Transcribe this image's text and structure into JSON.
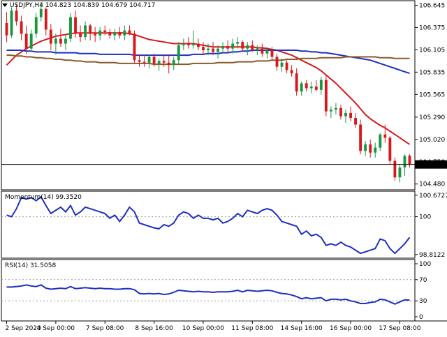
{
  "title": {
    "symbol": "USDJPY,H4",
    "ohlc": "104.823 104.839 104.679 104.717"
  },
  "colors": {
    "bull": "#1a9641",
    "bear": "#d7191c",
    "ma_fast": "#d7191c",
    "ma_mid": "#1f2fbf",
    "ma_slow": "#8b5a2b",
    "indicator": "#1f2fbf",
    "grid": "#9a9a9a",
    "current_price_bg": "#000000",
    "current_price_text": "#ffffff"
  },
  "chart_data": [
    {
      "type": "candlestick",
      "title": "USDJPY,H4",
      "ylim": [
        104.41,
        106.7
      ],
      "y_ticks": [
        "106.645",
        "106.375",
        "106.105",
        "105.835",
        "105.565",
        "105.290",
        "105.020",
        "104.750",
        "104.480"
      ],
      "current_price": "104.717",
      "current_value": 104.717,
      "x_tick_labels": [
        "2 Sep 2020",
        "4 Sep 00:00",
        "7 Sep 08:00",
        "8 Sep 16:00",
        "10 Sep 00:00",
        "11 Sep 08:00",
        "14 Sep 16:00",
        "16 Sep 00:00",
        "17 Sep 08:00"
      ],
      "x_tick_index": [
        0,
        10,
        20,
        30,
        40,
        50,
        60,
        70,
        80
      ],
      "candles": [
        {
          "o": 106.43,
          "h": 106.56,
          "l": 106.2,
          "c": 106.28
        },
        {
          "o": 106.28,
          "h": 106.62,
          "l": 106.25,
          "c": 106.58
        },
        {
          "o": 106.58,
          "h": 106.65,
          "l": 106.4,
          "c": 106.45
        },
        {
          "o": 106.45,
          "h": 106.52,
          "l": 106.22,
          "c": 106.3
        },
        {
          "o": 106.3,
          "h": 106.4,
          "l": 106.05,
          "c": 106.12
        },
        {
          "o": 106.12,
          "h": 106.35,
          "l": 106.08,
          "c": 106.3
        },
        {
          "o": 106.3,
          "h": 106.55,
          "l": 106.25,
          "c": 106.5
        },
        {
          "o": 106.5,
          "h": 106.68,
          "l": 106.45,
          "c": 106.6
        },
        {
          "o": 106.6,
          "h": 106.62,
          "l": 106.28,
          "c": 106.35
        },
        {
          "o": 106.35,
          "h": 106.42,
          "l": 106.1,
          "c": 106.18
        },
        {
          "o": 106.18,
          "h": 106.3,
          "l": 106.05,
          "c": 106.24
        },
        {
          "o": 106.24,
          "h": 106.36,
          "l": 106.14,
          "c": 106.18
        },
        {
          "o": 106.18,
          "h": 106.3,
          "l": 106.1,
          "c": 106.24
        },
        {
          "o": 106.24,
          "h": 106.55,
          "l": 106.2,
          "c": 106.5
        },
        {
          "o": 106.5,
          "h": 106.58,
          "l": 106.25,
          "c": 106.3
        },
        {
          "o": 106.3,
          "h": 106.4,
          "l": 106.2,
          "c": 106.26
        },
        {
          "o": 106.26,
          "h": 106.45,
          "l": 106.22,
          "c": 106.4
        },
        {
          "o": 106.4,
          "h": 106.42,
          "l": 106.22,
          "c": 106.3
        },
        {
          "o": 106.3,
          "h": 106.38,
          "l": 106.2,
          "c": 106.28
        },
        {
          "o": 106.28,
          "h": 106.38,
          "l": 106.22,
          "c": 106.34
        },
        {
          "o": 106.34,
          "h": 106.4,
          "l": 106.28,
          "c": 106.32
        },
        {
          "o": 106.32,
          "h": 106.36,
          "l": 106.24,
          "c": 106.28
        },
        {
          "o": 106.28,
          "h": 106.36,
          "l": 106.22,
          "c": 106.32
        },
        {
          "o": 106.32,
          "h": 106.38,
          "l": 106.24,
          "c": 106.28
        },
        {
          "o": 106.28,
          "h": 106.4,
          "l": 106.22,
          "c": 106.34
        },
        {
          "o": 106.34,
          "h": 106.4,
          "l": 106.28,
          "c": 106.3
        },
        {
          "o": 106.3,
          "h": 106.34,
          "l": 105.95,
          "c": 105.98
        },
        {
          "o": 105.98,
          "h": 106.05,
          "l": 105.9,
          "c": 105.96
        },
        {
          "o": 105.96,
          "h": 106.04,
          "l": 105.9,
          "c": 105.95
        },
        {
          "o": 105.95,
          "h": 106.05,
          "l": 105.88,
          "c": 106.02
        },
        {
          "o": 106.02,
          "h": 106.06,
          "l": 105.9,
          "c": 105.94
        },
        {
          "o": 105.94,
          "h": 106.0,
          "l": 105.85,
          "c": 105.97
        },
        {
          "o": 105.97,
          "h": 106.04,
          "l": 105.9,
          "c": 105.95
        },
        {
          "o": 105.95,
          "h": 106.05,
          "l": 105.82,
          "c": 105.92
        },
        {
          "o": 105.92,
          "h": 106.02,
          "l": 105.86,
          "c": 105.98
        },
        {
          "o": 105.98,
          "h": 106.2,
          "l": 105.92,
          "c": 106.16
        },
        {
          "o": 106.16,
          "h": 106.24,
          "l": 106.1,
          "c": 106.18
        },
        {
          "o": 106.18,
          "h": 106.26,
          "l": 106.12,
          "c": 106.16
        },
        {
          "o": 106.16,
          "h": 106.34,
          "l": 106.12,
          "c": 106.18
        },
        {
          "o": 106.18,
          "h": 106.24,
          "l": 106.1,
          "c": 106.14
        },
        {
          "o": 106.14,
          "h": 106.2,
          "l": 106.04,
          "c": 106.1
        },
        {
          "o": 106.1,
          "h": 106.18,
          "l": 106.04,
          "c": 106.12
        },
        {
          "o": 106.12,
          "h": 106.2,
          "l": 106.04,
          "c": 106.08
        },
        {
          "o": 106.08,
          "h": 106.16,
          "l": 106.0,
          "c": 106.12
        },
        {
          "o": 106.12,
          "h": 106.2,
          "l": 106.06,
          "c": 106.15
        },
        {
          "o": 106.15,
          "h": 106.22,
          "l": 106.08,
          "c": 106.12
        },
        {
          "o": 106.12,
          "h": 106.24,
          "l": 106.06,
          "c": 106.18
        },
        {
          "o": 106.18,
          "h": 106.26,
          "l": 106.12,
          "c": 106.2
        },
        {
          "o": 106.2,
          "h": 106.22,
          "l": 106.08,
          "c": 106.12
        },
        {
          "o": 106.12,
          "h": 106.2,
          "l": 106.04,
          "c": 106.16
        },
        {
          "o": 106.16,
          "h": 106.22,
          "l": 106.08,
          "c": 106.1
        },
        {
          "o": 106.1,
          "h": 106.16,
          "l": 106.04,
          "c": 106.12
        },
        {
          "o": 106.12,
          "h": 106.18,
          "l": 106.02,
          "c": 106.06
        },
        {
          "o": 106.06,
          "h": 106.14,
          "l": 106.0,
          "c": 106.1
        },
        {
          "o": 106.1,
          "h": 106.14,
          "l": 105.98,
          "c": 106.02
        },
        {
          "o": 106.02,
          "h": 106.06,
          "l": 105.85,
          "c": 105.9
        },
        {
          "o": 105.9,
          "h": 106.0,
          "l": 105.84,
          "c": 105.95
        },
        {
          "o": 105.95,
          "h": 105.98,
          "l": 105.82,
          "c": 105.86
        },
        {
          "o": 105.86,
          "h": 105.92,
          "l": 105.78,
          "c": 105.82
        },
        {
          "o": 105.82,
          "h": 105.88,
          "l": 105.55,
          "c": 105.6
        },
        {
          "o": 105.6,
          "h": 105.72,
          "l": 105.55,
          "c": 105.7
        },
        {
          "o": 105.7,
          "h": 105.74,
          "l": 105.6,
          "c": 105.64
        },
        {
          "o": 105.64,
          "h": 105.72,
          "l": 105.58,
          "c": 105.66
        },
        {
          "o": 105.66,
          "h": 105.74,
          "l": 105.6,
          "c": 105.62
        },
        {
          "o": 105.62,
          "h": 105.78,
          "l": 105.56,
          "c": 105.74
        },
        {
          "o": 105.74,
          "h": 105.8,
          "l": 105.3,
          "c": 105.36
        },
        {
          "o": 105.36,
          "h": 105.42,
          "l": 105.28,
          "c": 105.38
        },
        {
          "o": 105.38,
          "h": 105.46,
          "l": 105.32,
          "c": 105.4
        },
        {
          "o": 105.4,
          "h": 105.44,
          "l": 105.26,
          "c": 105.3
        },
        {
          "o": 105.3,
          "h": 105.38,
          "l": 105.22,
          "c": 105.34
        },
        {
          "o": 105.34,
          "h": 105.42,
          "l": 105.24,
          "c": 105.28
        },
        {
          "o": 105.28,
          "h": 105.34,
          "l": 105.16,
          "c": 105.2
        },
        {
          "o": 105.2,
          "h": 105.26,
          "l": 104.84,
          "c": 104.88
        },
        {
          "o": 104.88,
          "h": 105.0,
          "l": 104.82,
          "c": 104.96
        },
        {
          "o": 104.96,
          "h": 105.02,
          "l": 104.8,
          "c": 104.86
        },
        {
          "o": 104.86,
          "h": 104.98,
          "l": 104.8,
          "c": 104.92
        },
        {
          "o": 104.92,
          "h": 105.1,
          "l": 104.88,
          "c": 105.08
        },
        {
          "o": 105.08,
          "h": 105.2,
          "l": 104.98,
          "c": 105.04
        },
        {
          "o": 105.04,
          "h": 105.06,
          "l": 104.72,
          "c": 104.76
        },
        {
          "o": 104.76,
          "h": 104.8,
          "l": 104.52,
          "c": 104.56
        },
        {
          "o": 104.56,
          "h": 104.72,
          "l": 104.5,
          "c": 104.68
        },
        {
          "o": 104.68,
          "h": 104.84,
          "l": 104.58,
          "c": 104.82
        },
        {
          "o": 104.823,
          "h": 104.839,
          "l": 104.679,
          "c": 104.717
        }
      ],
      "series": [
        {
          "key": "ma_fast",
          "values": [
            105.92,
            105.98,
            106.04,
            106.08,
            106.12,
            106.15,
            106.18,
            106.21,
            106.23,
            106.25,
            106.27,
            106.28,
            106.29,
            106.3,
            106.31,
            106.31,
            106.31,
            106.31,
            106.31,
            106.31,
            106.31,
            106.31,
            106.31,
            106.31,
            106.31,
            106.3,
            106.29,
            106.27,
            106.25,
            106.23,
            106.22,
            106.21,
            106.2,
            106.19,
            106.18,
            106.18,
            106.18,
            106.18,
            106.18,
            106.17,
            106.16,
            106.15,
            106.14,
            106.14,
            106.14,
            106.14,
            106.14,
            106.14,
            106.14,
            106.14,
            106.14,
            106.13,
            106.13,
            106.12,
            106.11,
            106.1,
            106.08,
            106.06,
            106.04,
            106.01,
            105.98,
            105.95,
            105.92,
            105.89,
            105.85,
            105.8,
            105.75,
            105.7,
            105.64,
            105.58,
            105.52,
            105.46,
            105.39,
            105.32,
            105.27,
            105.23,
            105.19,
            105.16,
            105.12,
            105.08,
            105.04,
            105.0,
            104.96
          ]
        },
        {
          "key": "ma_mid",
          "values": [
            106.1,
            106.1,
            106.1,
            106.1,
            106.09,
            106.09,
            106.08,
            106.08,
            106.08,
            106.08,
            106.07,
            106.07,
            106.07,
            106.07,
            106.07,
            106.06,
            106.06,
            106.06,
            106.06,
            106.05,
            106.05,
            106.05,
            106.05,
            106.05,
            106.05,
            106.05,
            106.04,
            106.04,
            106.04,
            106.04,
            106.04,
            106.04,
            106.04,
            106.04,
            106.04,
            106.04,
            106.04,
            106.04,
            106.05,
            106.05,
            106.05,
            106.06,
            106.06,
            106.06,
            106.07,
            106.07,
            106.08,
            106.08,
            106.09,
            106.09,
            106.1,
            106.1,
            106.1,
            106.1,
            106.1,
            106.1,
            106.1,
            106.1,
            106.1,
            106.1,
            106.09,
            106.09,
            106.08,
            106.08,
            106.07,
            106.07,
            106.06,
            106.05,
            106.04,
            106.03,
            106.02,
            106.01,
            106.0,
            105.99,
            105.98,
            105.96,
            105.94,
            105.92,
            105.9,
            105.88,
            105.86,
            105.84,
            105.82
          ]
        },
        {
          "key": "ma_slow",
          "values": [
            106.04,
            106.04,
            106.03,
            106.03,
            106.02,
            106.02,
            106.01,
            106.01,
            106.0,
            106.0,
            105.99,
            105.99,
            105.98,
            105.98,
            105.97,
            105.97,
            105.96,
            105.96,
            105.96,
            105.95,
            105.95,
            105.95,
            105.95,
            105.94,
            105.94,
            105.94,
            105.94,
            105.94,
            105.94,
            105.94,
            105.93,
            105.93,
            105.93,
            105.93,
            105.93,
            105.93,
            105.93,
            105.93,
            105.94,
            105.94,
            105.94,
            105.94,
            105.94,
            105.95,
            105.95,
            105.95,
            105.95,
            105.96,
            105.96,
            105.96,
            105.96,
            105.97,
            105.97,
            105.97,
            105.98,
            105.98,
            105.98,
            105.99,
            105.99,
            105.99,
            106.0,
            106.0,
            106.0,
            106.0,
            106.01,
            106.01,
            106.01,
            106.01,
            106.01,
            106.02,
            106.02,
            106.02,
            106.02,
            106.02,
            106.02,
            106.02,
            106.01,
            106.01,
            106.01,
            106.0,
            106.0,
            106.0,
            106.0
          ]
        }
      ]
    },
    {
      "type": "line",
      "title": "Momentum(14) 99.3520",
      "ylim": [
        98.7,
        100.8
      ],
      "y_ticks": [
        "100.6727",
        "100",
        "98.8122"
      ],
      "reference_level": 100,
      "values": [
        100.05,
        100.0,
        100.25,
        100.6,
        100.55,
        100.6,
        100.5,
        100.62,
        100.35,
        100.1,
        100.2,
        100.3,
        100.15,
        100.35,
        100.05,
        100.15,
        100.3,
        100.25,
        100.2,
        100.15,
        100.1,
        99.95,
        100.05,
        99.85,
        100.05,
        100.3,
        100.15,
        99.8,
        99.75,
        99.7,
        99.65,
        99.62,
        99.75,
        99.7,
        99.8,
        100.05,
        100.15,
        100.1,
        99.95,
        100.05,
        99.95,
        99.95,
        99.9,
        99.95,
        99.8,
        99.85,
        99.95,
        100.1,
        100.0,
        100.2,
        100.15,
        100.1,
        100.2,
        100.25,
        100.2,
        100.05,
        99.85,
        99.8,
        99.75,
        99.7,
        99.45,
        99.55,
        99.4,
        99.45,
        99.35,
        99.1,
        99.15,
        99.1,
        99.2,
        99.1,
        99.05,
        98.95,
        98.85,
        98.9,
        98.95,
        99.0,
        99.3,
        99.25,
        99.0,
        98.85,
        99.0,
        99.15,
        99.35
      ]
    },
    {
      "type": "line",
      "title": "RSI(14) 31.5058",
      "ylim": [
        0,
        100
      ],
      "y_ticks": [
        "100",
        "70",
        "30",
        "0"
      ],
      "levels": [
        70,
        30
      ],
      "values": [
        56,
        56,
        57,
        58,
        60,
        58,
        57,
        60,
        54,
        52,
        53,
        54,
        53,
        57,
        53,
        54,
        55,
        54,
        53,
        54,
        53,
        53,
        52,
        52,
        53,
        53,
        51,
        44,
        43,
        44,
        43,
        44,
        42,
        43,
        46,
        50,
        49,
        48,
        47,
        48,
        47,
        47,
        46,
        47,
        47,
        47,
        48,
        50,
        47,
        50,
        49,
        48,
        49,
        50,
        49,
        46,
        44,
        43,
        41,
        38,
        34,
        36,
        34,
        35,
        36,
        30,
        33,
        33,
        32,
        33,
        30,
        28,
        25,
        25,
        27,
        28,
        33,
        32,
        28,
        24,
        28,
        32,
        31.5
      ]
    }
  ]
}
